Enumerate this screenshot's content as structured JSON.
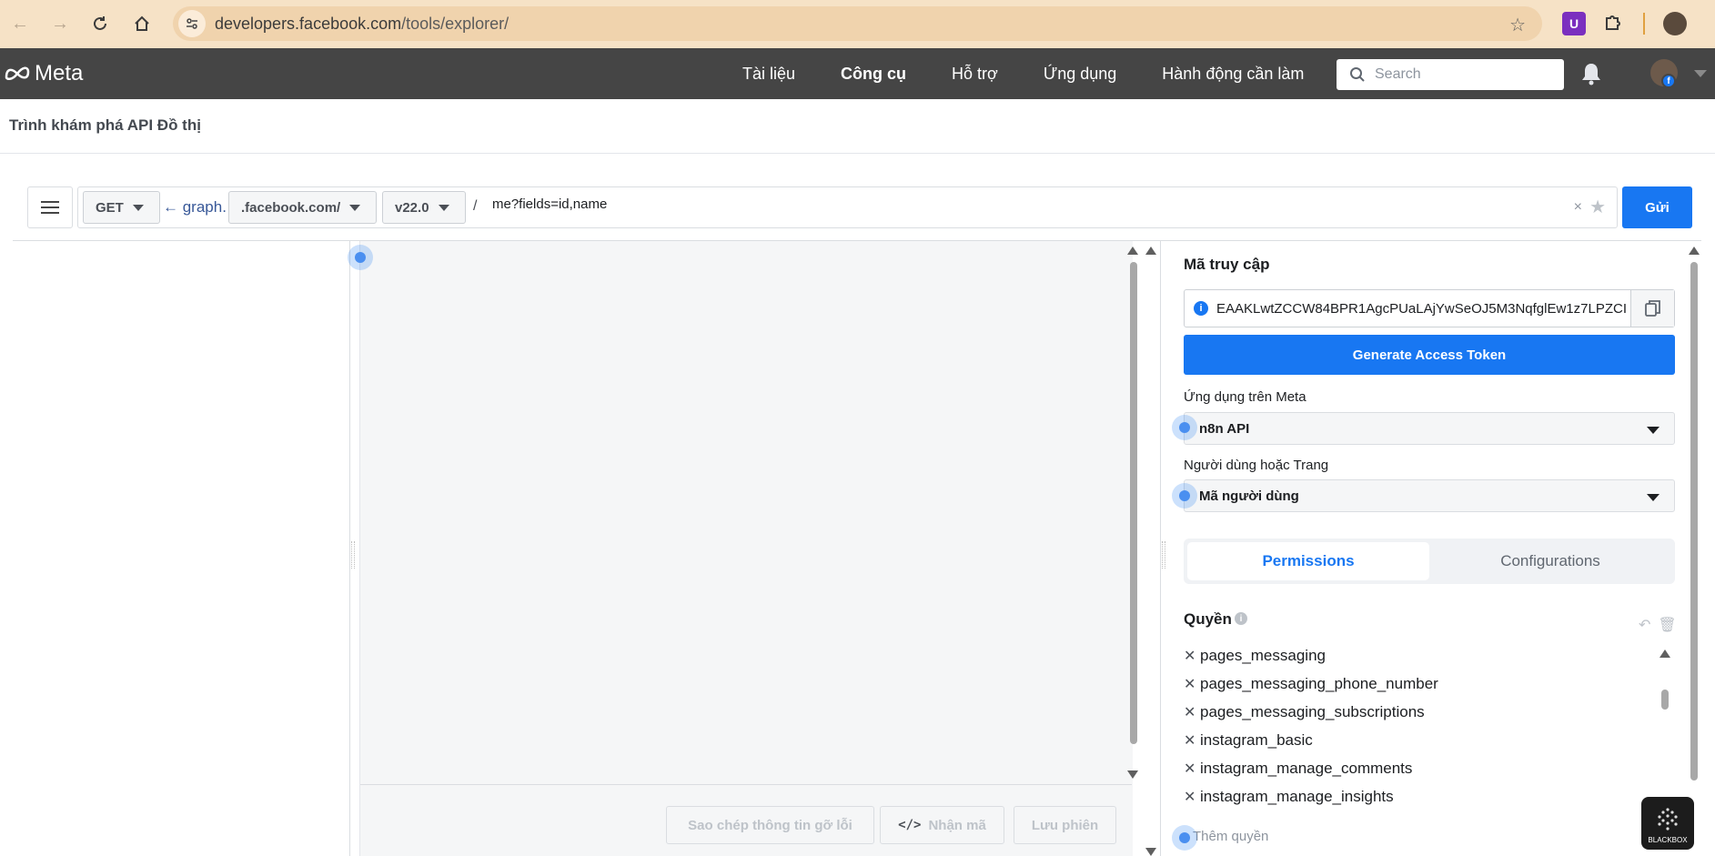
{
  "browser": {
    "url_host": "developers.facebook.com",
    "url_path": "/tools/explorer/"
  },
  "header": {
    "logo_text": "Meta",
    "nav": [
      "Tài liệu",
      "Công cụ",
      "Hỗ trợ",
      "Ứng dụng",
      "Hành động cần làm"
    ],
    "search_placeholder": "Search"
  },
  "page": {
    "title": "Trình khám phá API Đồ thị"
  },
  "request": {
    "method": "GET",
    "graph_prefix": "← graph.",
    "domain": ".facebook.com/",
    "version": "v22.0",
    "slash": "/",
    "path": "me?fields=id,name",
    "clear": "×",
    "send_label": "Gửi"
  },
  "main": {
    "copy_debug_label": "Sao chép thông tin gỡ lỗi",
    "get_code_icon": "</>",
    "get_code_label": "Nhận mã",
    "save_session_label": "Lưu phiên"
  },
  "right": {
    "access_token_heading": "Mã truy cập",
    "access_token_value": "EAAKLwtZCCW84BPR1AgcPUaLAjYwSeOJ5M3NqfglEw1z7LPZCI",
    "generate_label": "Generate Access Token",
    "app_label": "Ứng dụng trên Meta",
    "app_value": "n8n API",
    "user_label": "Người dùng hoặc Trang",
    "user_value": "Mã người dùng",
    "tabs": [
      "Permissions",
      "Configurations"
    ],
    "permissions_heading": "Quyền",
    "permissions": [
      "pages_messaging",
      "pages_messaging_phone_number",
      "pages_messaging_subscriptions",
      "instagram_basic",
      "instagram_manage_comments",
      "instagram_manage_insights"
    ],
    "add_permission_label": "Thêm quyền"
  },
  "widget": {
    "blackbox_label": "BLACKBOX"
  },
  "colors": {
    "brand_blue": "#1877f2",
    "header_bg": "#454545",
    "browser_bg": "#f6e2c6"
  }
}
